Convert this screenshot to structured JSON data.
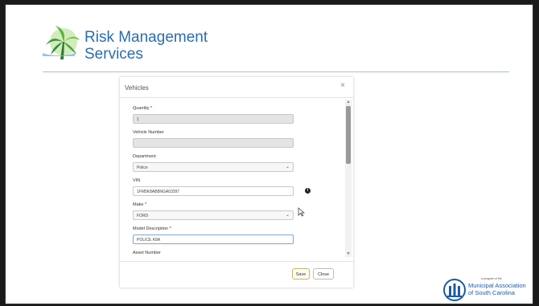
{
  "branding": {
    "title_line1": "Risk Management",
    "title_line2": "Services",
    "partner_small": "a program of the",
    "partner_line1": "Municipal Association",
    "partner_line2": "of South Carolina"
  },
  "dialog": {
    "title": "Vehicles",
    "close_glyph": "×",
    "fields": [
      {
        "label": "Quantity",
        "required": true,
        "value": "1",
        "type": "disabled"
      },
      {
        "label": "Vehicle Number",
        "required": false,
        "value": "",
        "type": "disabled"
      },
      {
        "label": "Department",
        "required": false,
        "value": "Police",
        "type": "select"
      },
      {
        "label": "VIN",
        "required": false,
        "value": "1FM5K8AB8NGA03397",
        "type": "text",
        "info": true
      },
      {
        "label": "Make",
        "required": true,
        "value": "FORD",
        "type": "select"
      },
      {
        "label": "Model Description",
        "required": true,
        "value": "POLICE K8A",
        "type": "text-focus"
      },
      {
        "label": "Asset Number",
        "required": false,
        "value": "",
        "type": "text"
      }
    ],
    "required_mark": "*",
    "info_glyph": "i",
    "chevron_glyph": "⌄",
    "save_label": "Save",
    "close_label": "Close"
  },
  "icons": {
    "dialog_close": "close-icon",
    "info": "info-icon",
    "dropdown": "chevron-down-icon",
    "cursor": "mouse-pointer-icon"
  },
  "colors": {
    "brand_blue": "#2a6db0",
    "rule": "#9fc2e0",
    "required": "#cc0000",
    "save_border": "#c8b36a"
  }
}
